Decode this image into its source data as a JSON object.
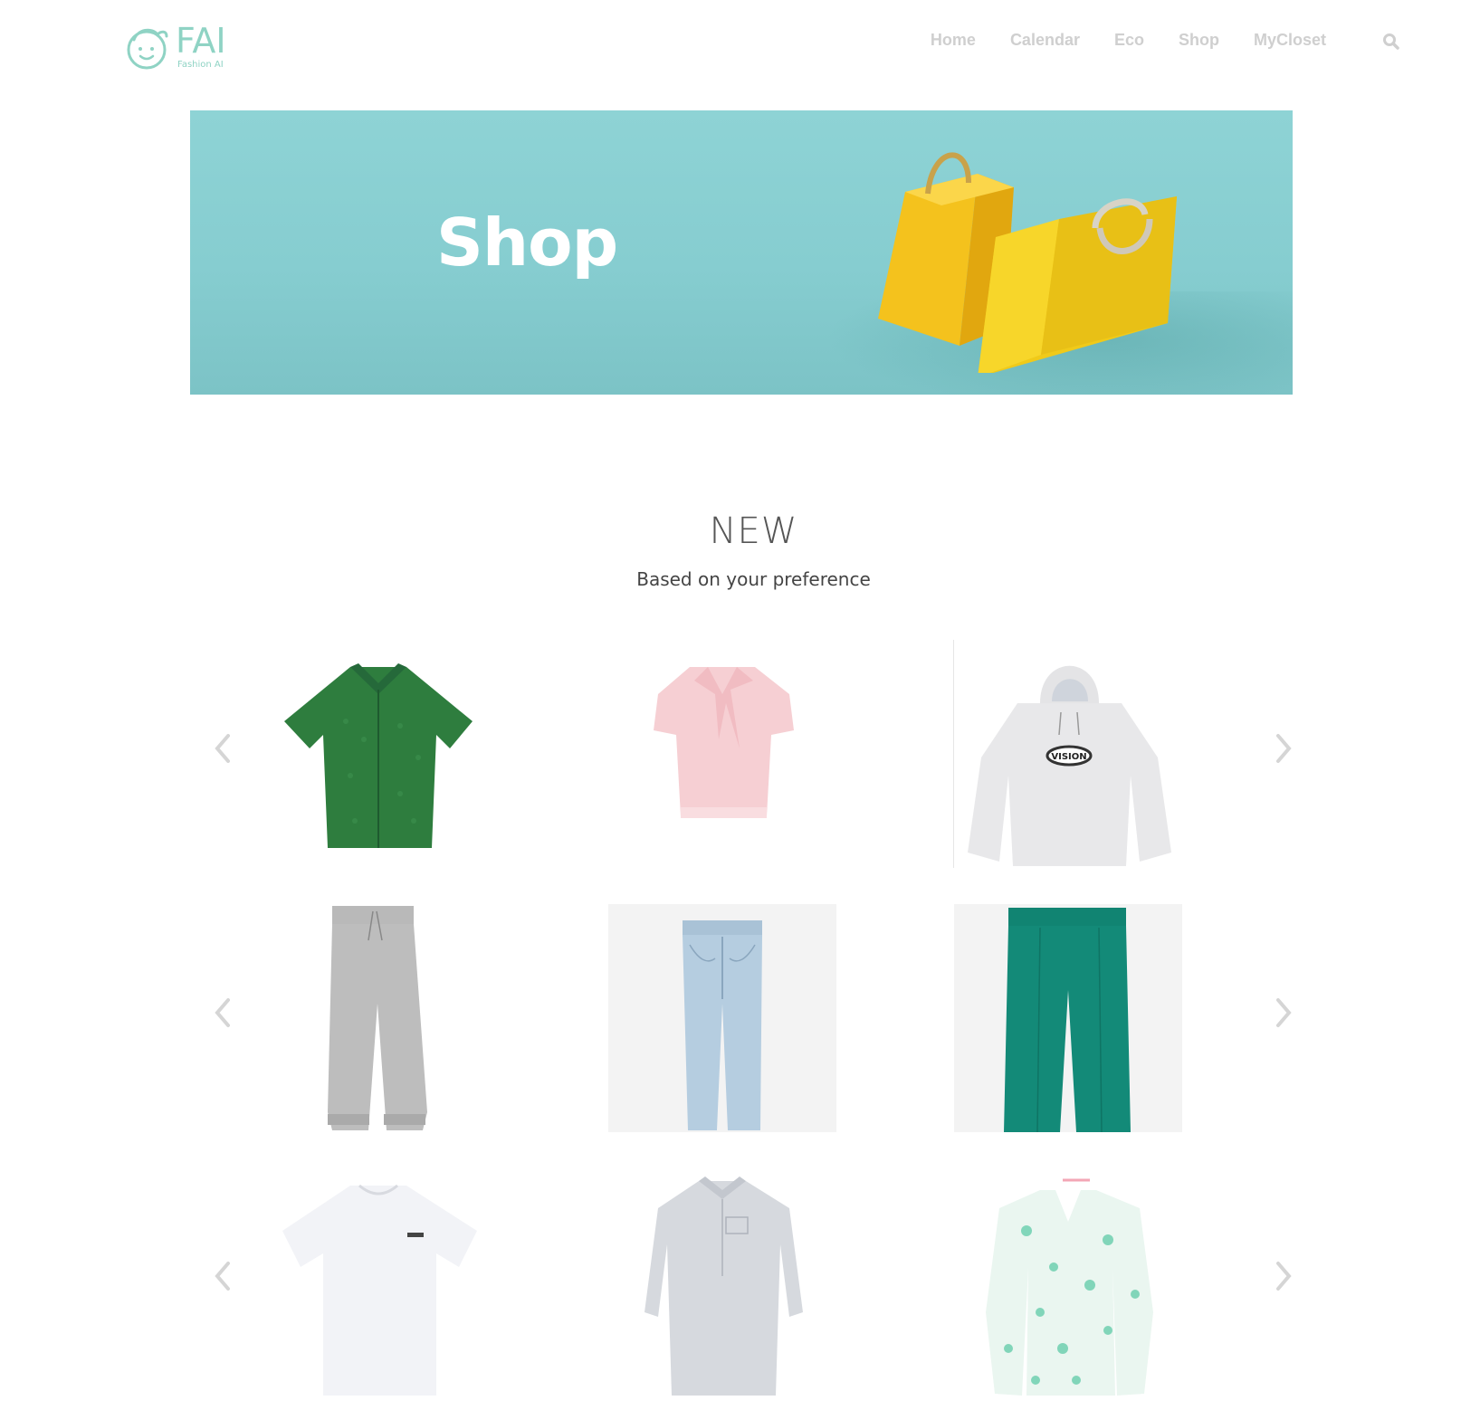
{
  "brand": {
    "name": "FAI",
    "tagline": "Fashion AI",
    "color": "#8fd3c4"
  },
  "nav": {
    "items": [
      {
        "label": "Home"
      },
      {
        "label": "Calendar"
      },
      {
        "label": "Eco"
      },
      {
        "label": "Shop"
      },
      {
        "label": "MyCloset"
      }
    ],
    "search_icon": "search-icon",
    "color": "#cfcfcf"
  },
  "banner": {
    "title": "Shop",
    "background": "#8ed3d5",
    "image": "shopping-bags"
  },
  "section": {
    "title": "NEW",
    "subtitle": "Based on your preference"
  },
  "rows": [
    {
      "prev_icon": "chevron-left-icon",
      "next_icon": "chevron-right-icon",
      "items": [
        {
          "name": "green-knit-shirt",
          "color": "#2e7d3e"
        },
        {
          "name": "pink-bow-blouse",
          "color": "#f6cfd3"
        },
        {
          "name": "grey-vision-hoodie",
          "color": "#e8e8ea"
        }
      ]
    },
    {
      "prev_icon": "chevron-left-icon",
      "next_icon": "chevron-right-icon",
      "items": [
        {
          "name": "grey-jogger-pants",
          "color": "#b9b9b9"
        },
        {
          "name": "light-blue-jeans",
          "color": "#b5cde0"
        },
        {
          "name": "teal-trousers",
          "color": "#138a78"
        }
      ]
    },
    {
      "prev_icon": "chevron-left-icon",
      "next_icon": "chevron-right-icon",
      "items": [
        {
          "name": "white-tshirt-dress",
          "color": "#f2f3f7"
        },
        {
          "name": "grey-shirt-dress",
          "color": "#d6d9de"
        },
        {
          "name": "mint-floral-dress",
          "color": "#9fdcc8"
        }
      ]
    }
  ]
}
